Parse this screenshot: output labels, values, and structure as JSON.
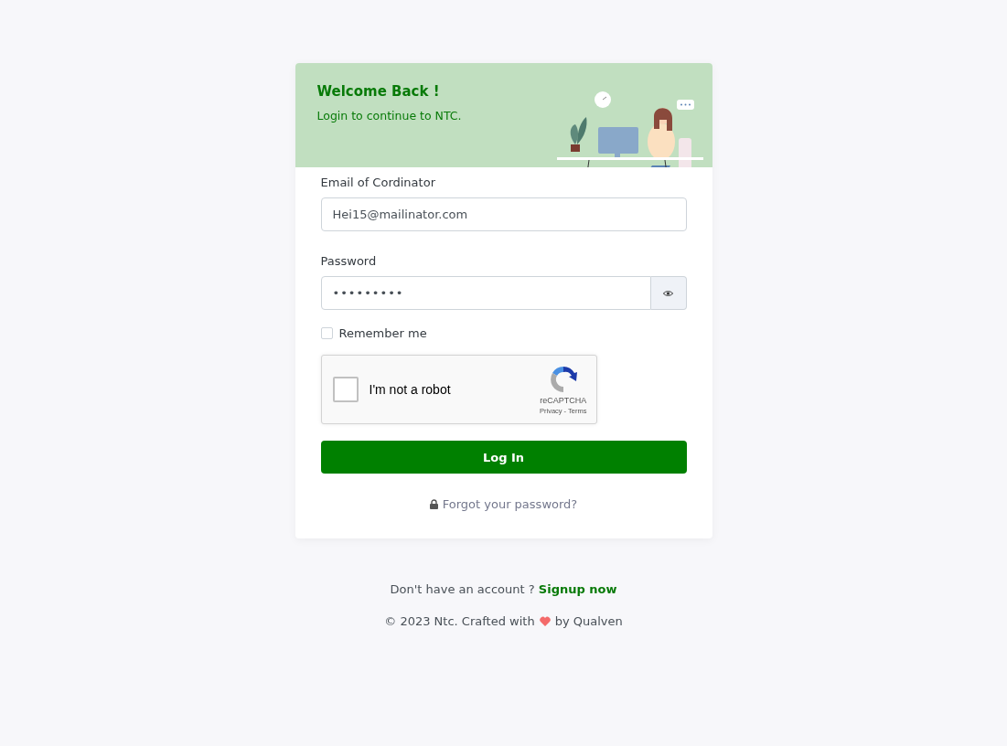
{
  "header": {
    "title": "Welcome Back !",
    "subtitle": "Login to continue to NTC."
  },
  "fields": [
    {
      "kind": "text",
      "label": "Email of Cordinator",
      "value": "Hei15@mailinator.com"
    },
    {
      "kind": "password",
      "label": "Password",
      "value": "•••••••••"
    }
  ],
  "remember": {
    "label": "Remember me",
    "checked": false
  },
  "captcha": {
    "label": "I'm not a robot",
    "checked": false,
    "brand": "reCAPTCHA",
    "privacy": "Privacy",
    "separator": "-",
    "terms": "Terms"
  },
  "login_button": "Log In",
  "forgot_link": "Forgot your password?",
  "signup": {
    "text": "Don't have an account ?",
    "link": "Signup now"
  },
  "footer": {
    "before": "© 2023 Ntc. Crafted with",
    "after": "by Qualven"
  }
}
